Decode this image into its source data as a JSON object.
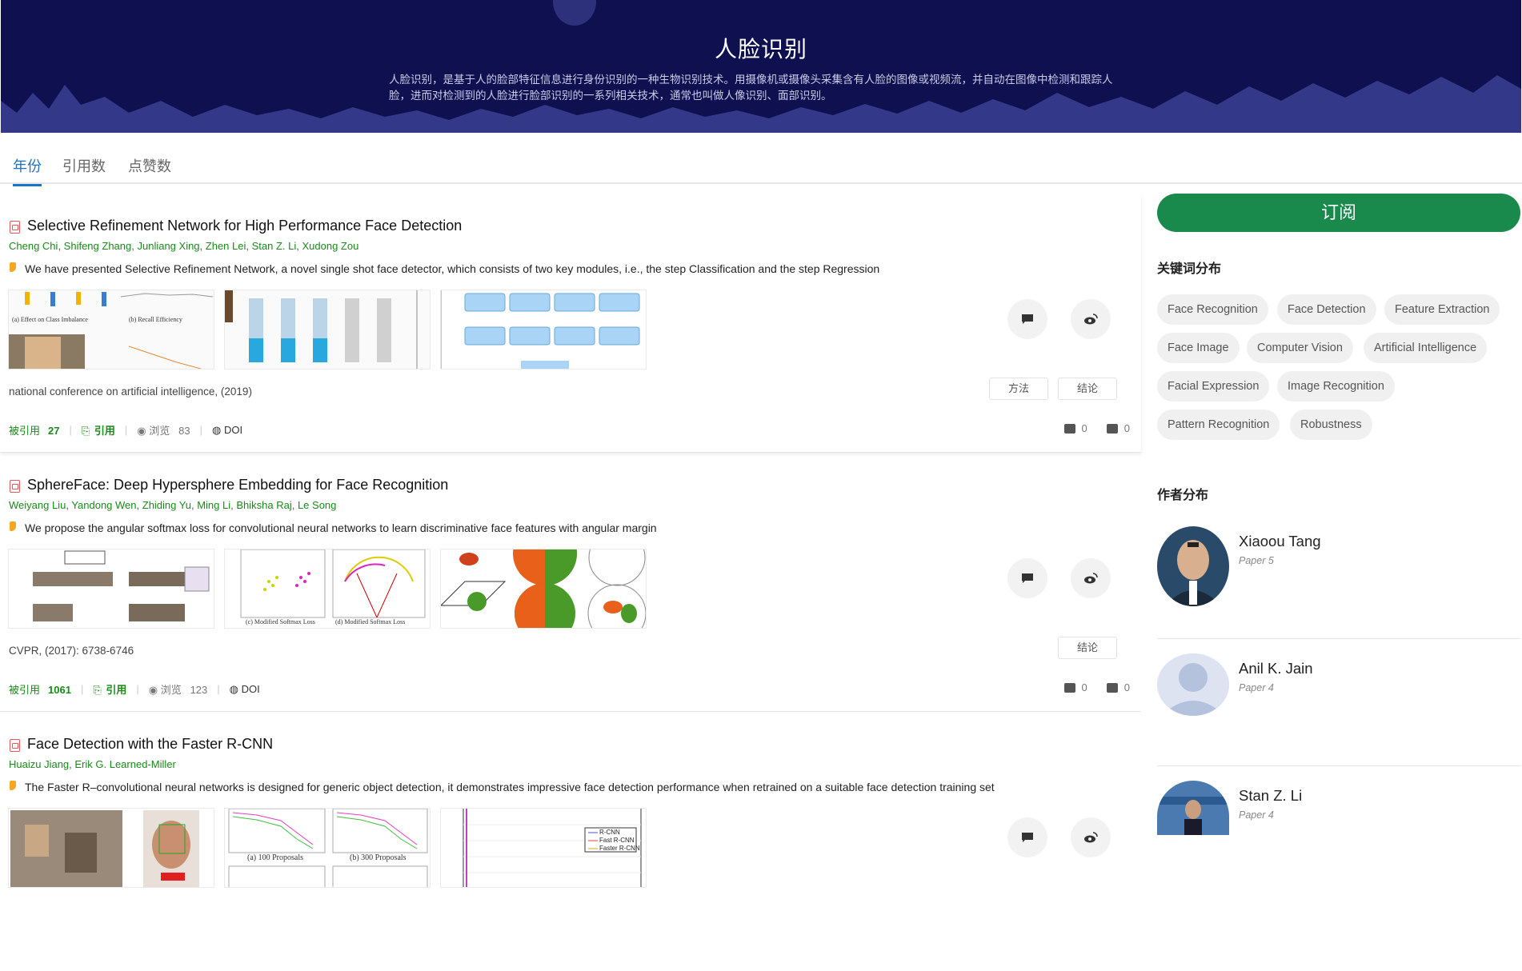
{
  "hero": {
    "title": "人脸识别",
    "description": "人脸识别，是基于人的脸部特征信息进行身份识别的一种生物识别技术。用摄像机或摄像头采集含有人脸的图像或视频流，并自动在图像中检测和跟踪人脸，进而对检测到的人脸进行脸部识别的一系列相关技术，通常也叫做人像识别、面部识别。"
  },
  "tabs": [
    {
      "label": "年份",
      "active": true
    },
    {
      "label": "引用数",
      "active": false
    },
    {
      "label": "点赞数",
      "active": false
    }
  ],
  "labels": {
    "cited_by": "被引用",
    "cite": "引用",
    "views": "浏览",
    "doi": "DOI"
  },
  "papers": [
    {
      "title": "Selective Refinement Network for High Performance Face Detection",
      "authors": [
        "Cheng Chi",
        "Shifeng Zhang",
        "Junliang Xing",
        "Zhen Lei",
        "Stan Z. Li",
        "Xudong Zou"
      ],
      "abstract": "We have presented Selective Refinement Network, a novel single shot face detector, which consists of two key modules, i.e., the step Classification and the step Regression",
      "venue": "national conference on artificial intelligence, (2019)",
      "tags": [
        "方法",
        "结论"
      ],
      "citations": "27",
      "views": "83",
      "likes": "0",
      "dislikes": "0",
      "figure_captions": [
        "(a) Effect on Class Imbalance",
        "(b) Recall Efficiency"
      ]
    },
    {
      "title": "SphereFace: Deep Hypersphere Embedding for Face Recognition",
      "authors": [
        "Weiyang Liu",
        "Yandong Wen",
        "Zhiding Yu",
        "Ming Li",
        "Bhiksha Raj",
        "Le Song"
      ],
      "abstract": "We propose the angular softmax loss for convolutional neural networks to learn discriminative face features with angular margin",
      "venue": "CVPR, (2017): 6738-6746",
      "tags": [
        "结论"
      ],
      "citations": "1061",
      "views": "123",
      "likes": "0",
      "dislikes": "0",
      "figure_captions": [
        "(c) Modified Softmax Loss",
        "(d) Modified Softmax Loss"
      ]
    },
    {
      "title": "Face Detection with the Faster R-CNN",
      "authors": [
        "Huaizu Jiang",
        "Erik G. Learned-Miller"
      ],
      "abstract": "The Faster R–convolutional neural networks is designed for generic object detection, it demonstrates impressive face detection performance when retrained on a suitable face detection training set",
      "venue": "",
      "tags": [],
      "citations": "",
      "views": "",
      "likes": "",
      "dislikes": "",
      "figure_captions": [
        "(a) 100 Proposals",
        "(b) 300 Proposals"
      ],
      "legend": [
        "R-CNN",
        "Fast R-CNN",
        "Faster R-CNN"
      ]
    }
  ],
  "sidebar": {
    "subscribe": "订阅",
    "keywords_title": "关键词分布",
    "keywords": [
      "Face Recognition",
      "Face Detection",
      "Feature Extraction",
      "Face Image",
      "Computer Vision",
      "Artificial Intelligence",
      "Facial Expression",
      "Image Recognition",
      "Pattern Recognition",
      "Robustness"
    ],
    "authors_title": "作者分布",
    "authors": [
      {
        "name": "Xiaoou Tang",
        "papers": "Paper 5"
      },
      {
        "name": "Anil K. Jain",
        "papers": "Paper 4"
      },
      {
        "name": "Stan Z. Li",
        "papers": "Paper 4"
      }
    ]
  },
  "colors": {
    "hero_bg": "#0f1050",
    "accent_blue": "#1a73c9",
    "author_green": "#1a8a1a",
    "subscribe_green": "#1a8a4c"
  }
}
